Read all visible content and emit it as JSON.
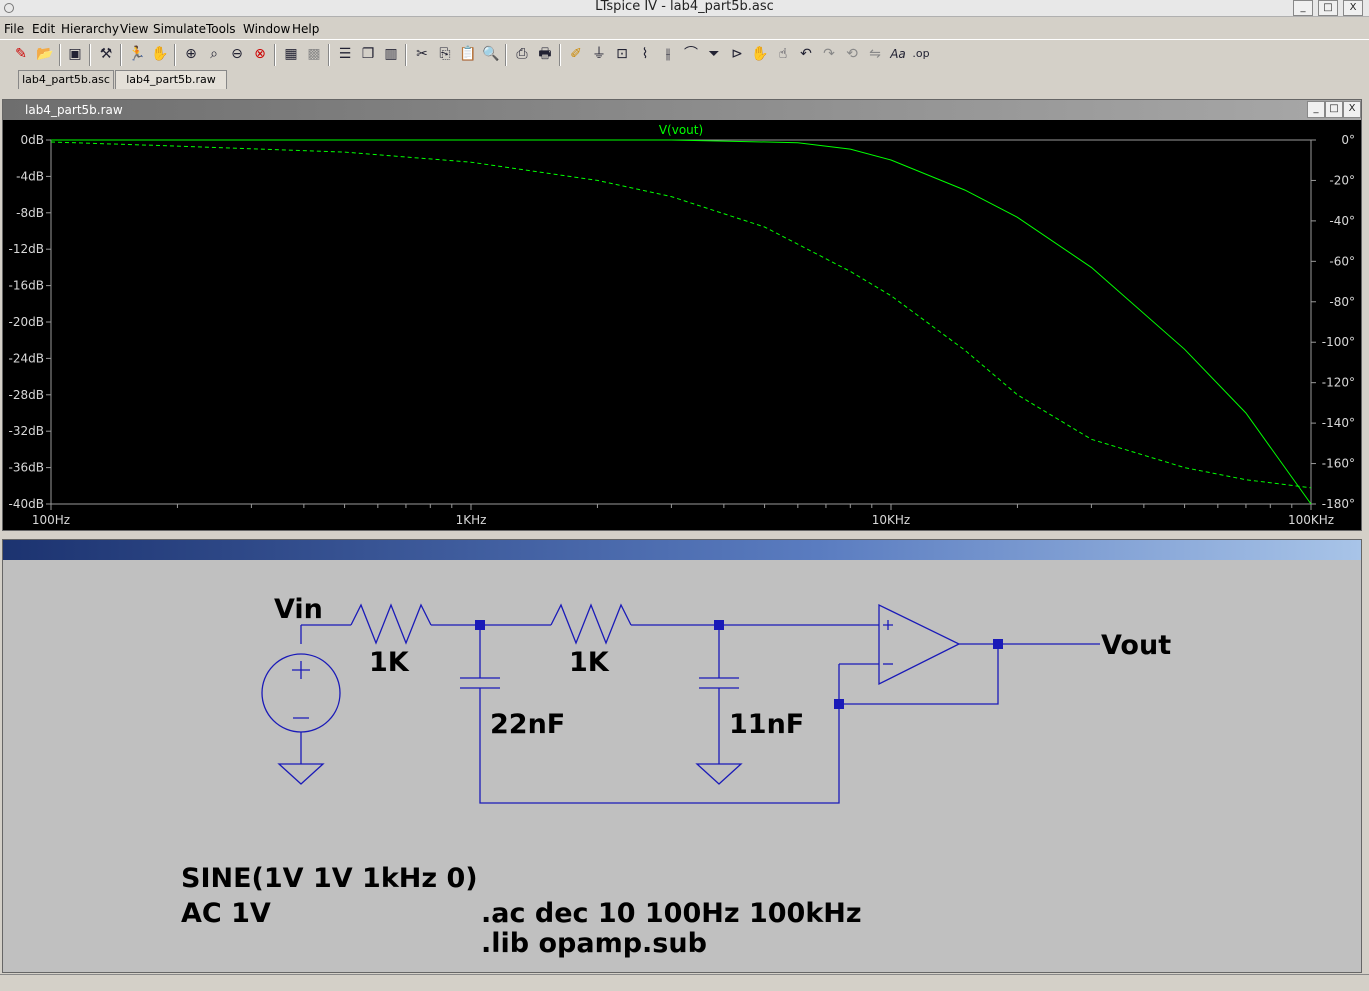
{
  "window": {
    "title": "LTspice IV - lab4_part5b.asc",
    "min": "_",
    "max": "□",
    "close": "X"
  },
  "menu": [
    "File",
    "Edit",
    "Hierarchy",
    "View",
    "Simulate",
    "Tools",
    "Window",
    "Help"
  ],
  "tabs": [
    "lab4_part5b.asc",
    "lab4_part5b.raw"
  ],
  "plot_window": {
    "title": "lab4_part5b.raw"
  },
  "chart_data": {
    "type": "line",
    "title": "V(vout)",
    "xscale": "log",
    "xlim": [
      100,
      100000
    ],
    "xticks": [
      "100Hz",
      "1KHz",
      "10KHz",
      "100KHz"
    ],
    "ylabel_left_ticks": [
      "0dB",
      "-4dB",
      "-8dB",
      "-12dB",
      "-16dB",
      "-20dB",
      "-24dB",
      "-28dB",
      "-32dB",
      "-36dB",
      "-40dB"
    ],
    "ylim_left": [
      -40,
      0
    ],
    "ylabel_right_ticks": [
      "0°",
      "-20°",
      "-40°",
      "-60°",
      "-80°",
      "-100°",
      "-120°",
      "-140°",
      "-160°",
      "-180°"
    ],
    "ylim_right": [
      -180,
      0
    ],
    "grid": false,
    "color": "#00ff00",
    "series": [
      {
        "name": "V(vout)",
        "axis": "left",
        "style": "solid",
        "x": [
          100,
          1000,
          3000,
          6000,
          8000,
          10000,
          15000,
          20000,
          30000,
          50000,
          70000,
          100000
        ],
        "y": [
          0,
          0,
          0,
          -0.3,
          -1.0,
          -2.2,
          -5.5,
          -8.5,
          -14,
          -23,
          -30,
          -40
        ]
      },
      {
        "axis": "right",
        "style": "dashed",
        "x": [
          100,
          200,
          500,
          1000,
          2000,
          3000,
          5000,
          8000,
          10000,
          15000,
          20000,
          30000,
          50000,
          70000,
          100000
        ],
        "y": [
          -1,
          -3,
          -6,
          -11,
          -20,
          -28,
          -43,
          -65,
          -77,
          -104,
          -126,
          -148,
          -162,
          -168,
          -172
        ]
      }
    ]
  },
  "schematic": {
    "vin_label": "Vin",
    "vout_label": "Vout",
    "r1_value": "1K",
    "r2_value": "1K",
    "c1_value": "22nF",
    "c2_value": "11nF",
    "source_line1": "SINE(1V 1V 1kHz 0)",
    "source_line2": "AC 1V",
    "directive1": ".ac dec 10 100Hz 100kHz",
    "directive2": ".lib opamp.sub",
    "wire_color": "#1a1ab8"
  }
}
